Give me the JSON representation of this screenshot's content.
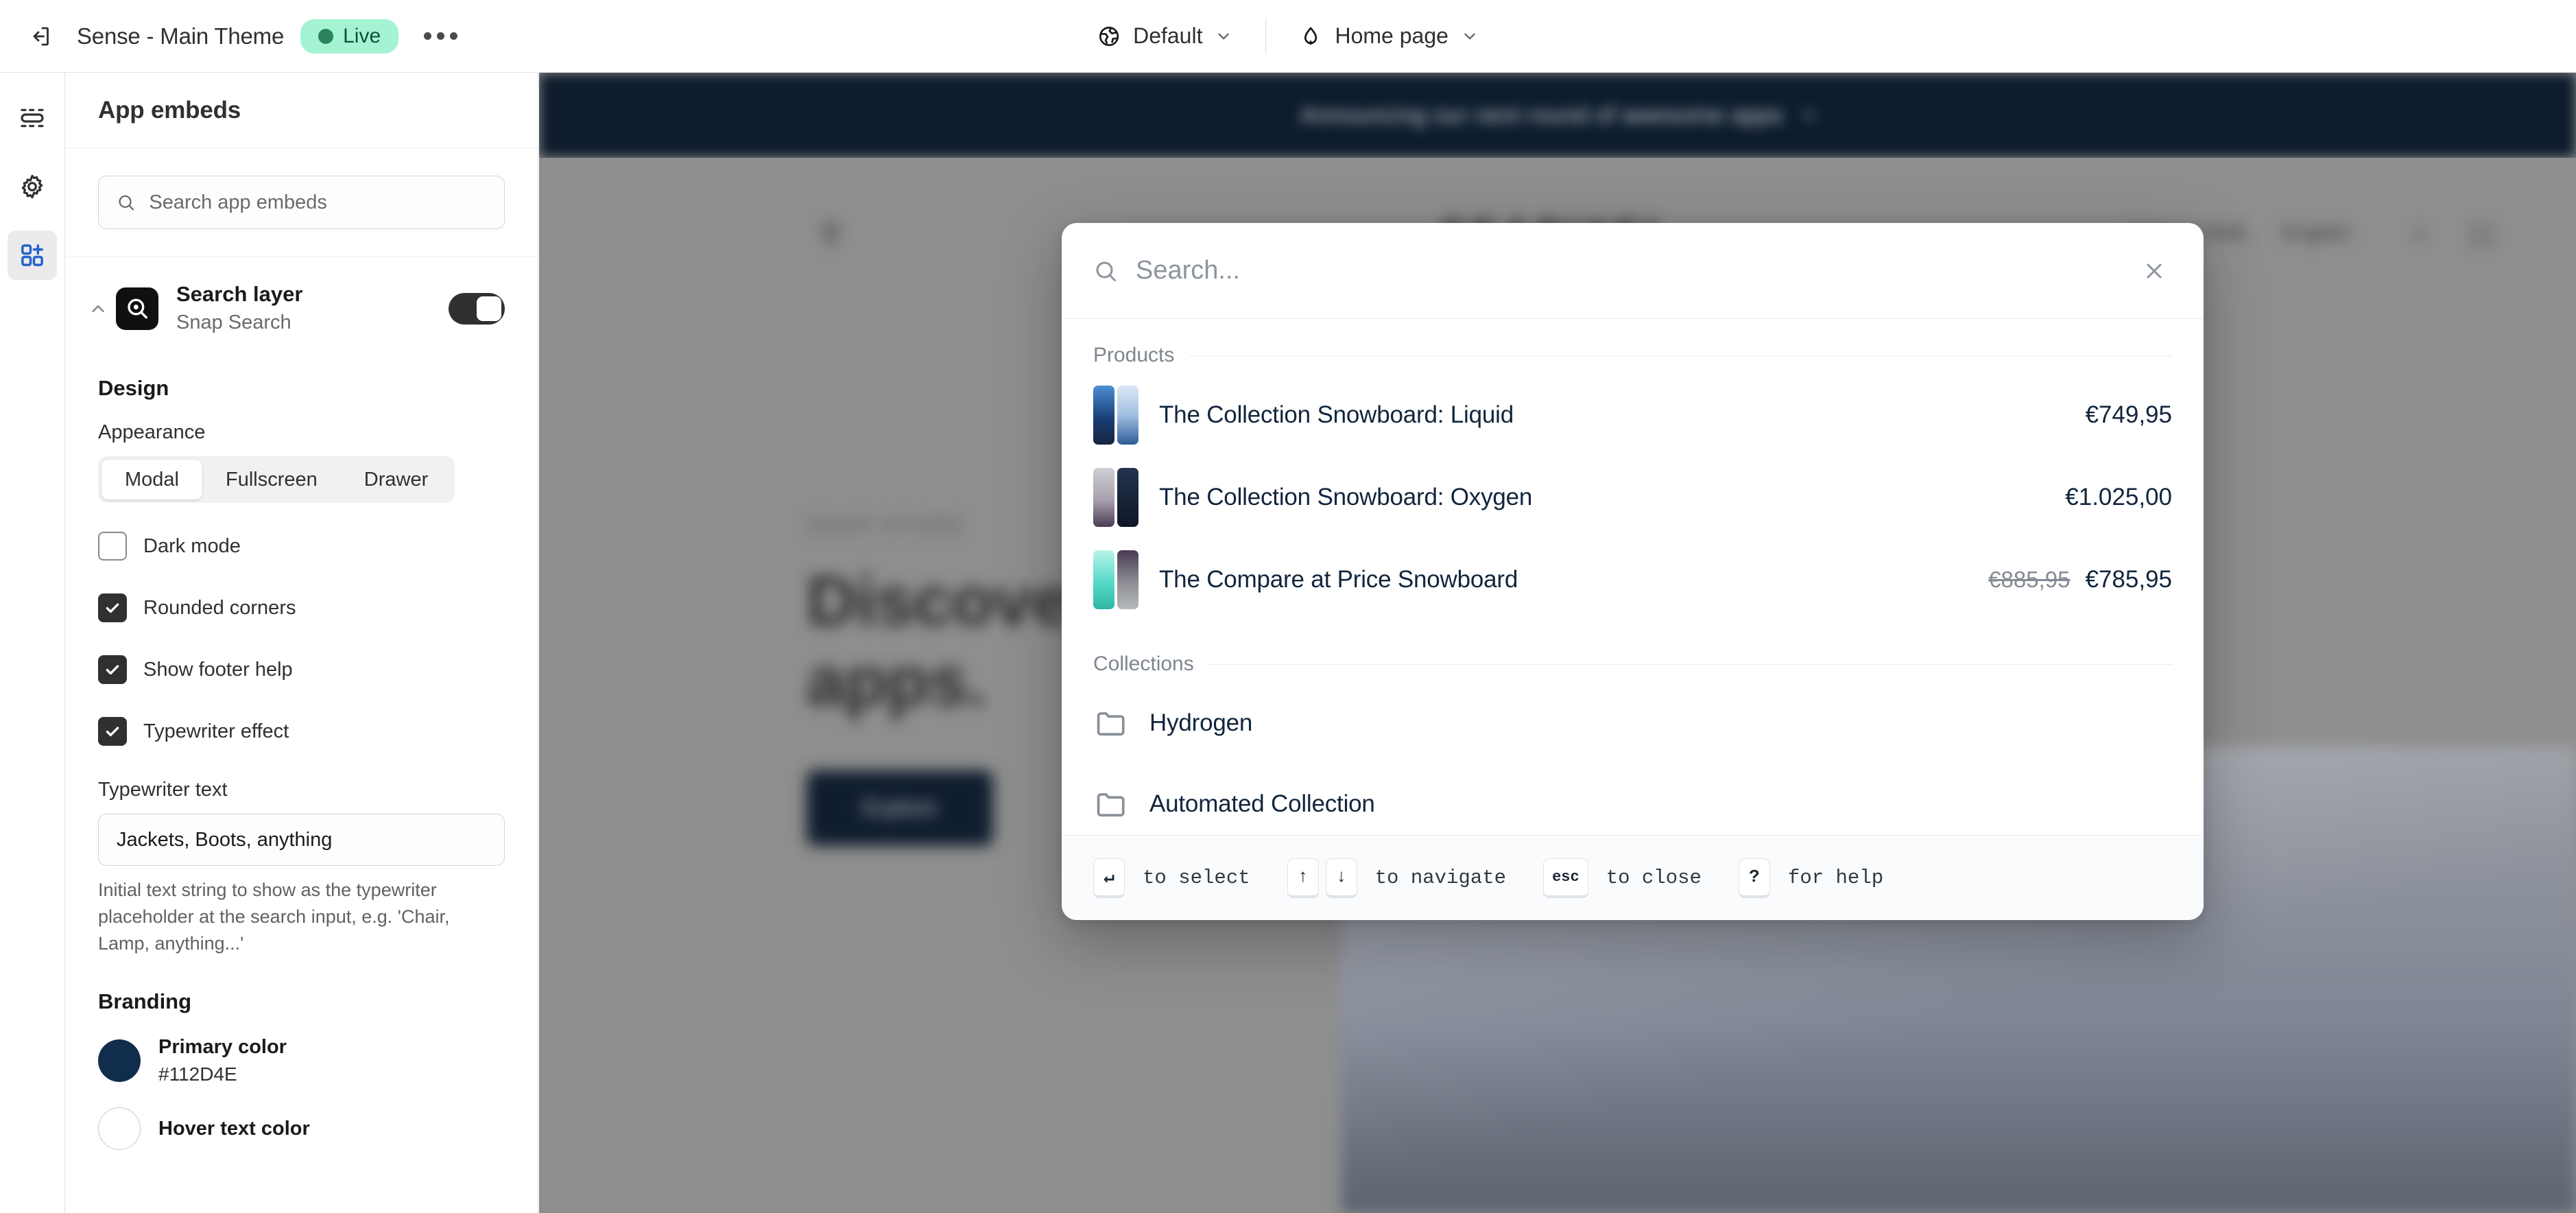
{
  "topbar": {
    "exit_icon": "exit-icon",
    "theme_name": "Sense - Main Theme",
    "status_badge": "Live",
    "more_actions": "…",
    "locale_selector": {
      "icon": "globe-icon",
      "label": "Default"
    },
    "page_selector": {
      "icon": "home-icon",
      "label": "Home page"
    }
  },
  "rail": {
    "items": [
      {
        "name": "sections-icon",
        "label": "Sections"
      },
      {
        "name": "gear-icon",
        "label": "Theme settings"
      },
      {
        "name": "apps-icon",
        "label": "Apps",
        "active": true
      }
    ]
  },
  "panel": {
    "title": "App embeds",
    "search": {
      "placeholder": "Search app embeds",
      "value": ""
    },
    "embed": {
      "title": "Search layer",
      "subtitle": "Snap Search",
      "enabled": true,
      "logo_icon": "snap-search-logo-icon",
      "collapse_icon": "chevron-up-icon"
    },
    "design": {
      "title": "Design",
      "appearance_label": "Appearance",
      "appearance_options": [
        "Modal",
        "Fullscreen",
        "Drawer"
      ],
      "appearance_selected": "Modal",
      "checkboxes": [
        {
          "label": "Dark mode",
          "checked": false
        },
        {
          "label": "Rounded corners",
          "checked": true
        },
        {
          "label": "Show footer help",
          "checked": true
        },
        {
          "label": "Typewriter effect",
          "checked": true
        }
      ],
      "typewriter_label": "Typewriter text",
      "typewriter_value": "Jackets, Boots, anything",
      "typewriter_help": "Initial text string to show as the typewriter placeholder at the search input, e.g. 'Chair, Lamp, anything...'"
    },
    "branding": {
      "title": "Branding",
      "colors": [
        {
          "name": "Primary color",
          "hex": "#112D4E"
        },
        {
          "name": "Hover text color",
          "hex": "#FFFFFF"
        }
      ]
    }
  },
  "preview": {
    "announcement": {
      "text": "Announcing our next round of awesome apps",
      "close": "×"
    },
    "store": {
      "logo": "SEAPIXEL",
      "search_icon": "search-icon",
      "nav": [
        "Stores / Shift",
        "English"
      ],
      "icons": [
        "account-icon",
        "cart-icon"
      ],
      "hero_eyebrow": "SNAP STORE",
      "hero_title": "Discover well-crafted apps.",
      "hero_button": "Explore"
    }
  },
  "modal": {
    "search": {
      "placeholder": "Search...",
      "value": ""
    },
    "close_icon": "close-icon",
    "groups": [
      {
        "label": "Products",
        "items": [
          {
            "title": "The Collection Snowboard: Liquid",
            "price": "€749,95",
            "compare_at": "",
            "thumb_left": "#2a5fa8",
            "thumb_right": "#18365f"
          },
          {
            "title": "The Collection Snowboard: Oxygen",
            "price": "€1.025,00",
            "compare_at": "",
            "thumb_left": "#9b97a3",
            "thumb_right": "#1d2b46"
          },
          {
            "title": "The Compare at Price Snowboard",
            "price": "€785,95",
            "compare_at": "€885,95",
            "thumb_left": "#7fe3d8",
            "thumb_right": "#6b6373"
          }
        ]
      },
      {
        "label": "Collections",
        "items": [
          {
            "title": "Hydrogen",
            "icon": "folder-icon"
          },
          {
            "title": "Automated Collection",
            "icon": "folder-icon"
          }
        ]
      }
    ],
    "footer": {
      "hints": [
        {
          "keys": [
            "↵"
          ],
          "text": "to select"
        },
        {
          "keys": [
            "↑",
            "↓"
          ],
          "text": "to navigate"
        },
        {
          "keys": [
            "esc"
          ],
          "text": "to close"
        },
        {
          "keys": [
            "?"
          ],
          "text": "for help"
        }
      ]
    }
  }
}
